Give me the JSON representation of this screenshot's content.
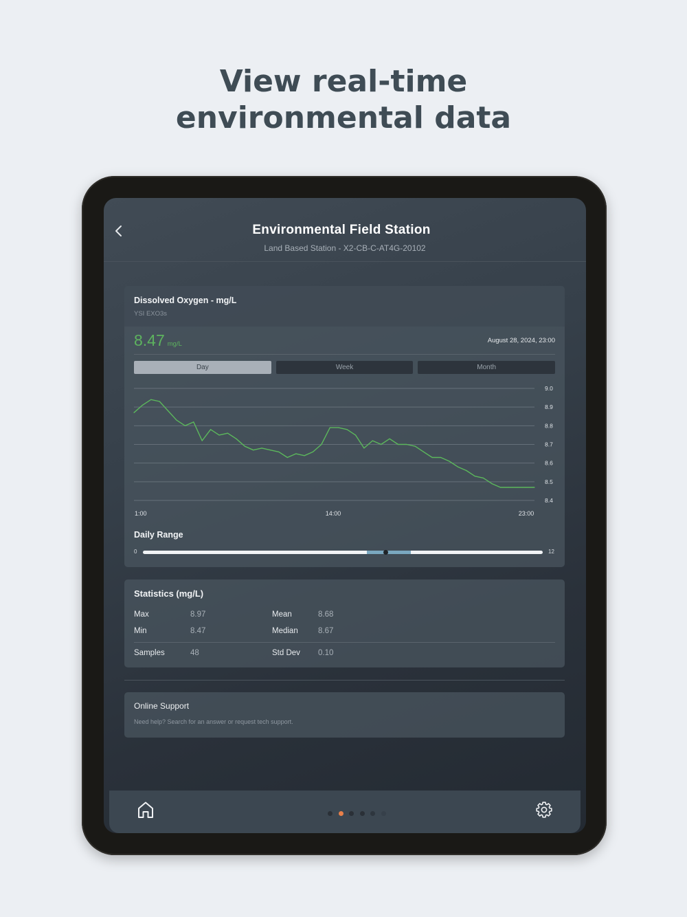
{
  "headline": {
    "line1": "View real-time",
    "line2": "environmental data"
  },
  "header": {
    "title": "Environmental Field Station",
    "subtitle": "Land Based Station - X2-CB-C-AT4G-20102"
  },
  "sensor": {
    "title": "Dissolved Oxygen - mg/L",
    "model": "YSI EXO3s",
    "value": "8.47",
    "unit": "mg/L",
    "timestamp": "August 28, 2024, 23:00",
    "value_color": "#5db35e"
  },
  "tabs": [
    {
      "label": "Day",
      "active": true
    },
    {
      "label": "Week",
      "active": false
    },
    {
      "label": "Month",
      "active": false
    }
  ],
  "chart_data": {
    "type": "line",
    "title": "",
    "xlabel": "",
    "ylabel": "",
    "ylim": [
      8.4,
      9.0
    ],
    "y_ticks": [
      "9.0",
      "8.9",
      "8.8",
      "8.7",
      "8.6",
      "8.5",
      "8.4"
    ],
    "x_tick_labels": [
      "1:00",
      "14:00",
      "23:00"
    ],
    "grid": true,
    "series": [
      {
        "color": "#5cb85c",
        "x": [
          1,
          1.5,
          2,
          2.5,
          3,
          3.5,
          4,
          4.5,
          5,
          5.5,
          6,
          6.5,
          7,
          7.5,
          8,
          8.5,
          9,
          9.5,
          10,
          10.5,
          11,
          11.5,
          12,
          12.5,
          13,
          13.5,
          14,
          14.5,
          15,
          15.5,
          16,
          16.5,
          17,
          17.5,
          18,
          18.5,
          19,
          19.5,
          20,
          20.5,
          21,
          21.5,
          22,
          22.5,
          23,
          23.5,
          24,
          24.5
        ],
        "values": [
          8.87,
          8.91,
          8.94,
          8.93,
          8.88,
          8.83,
          8.8,
          8.82,
          8.72,
          8.78,
          8.75,
          8.76,
          8.73,
          8.69,
          8.67,
          8.68,
          8.67,
          8.66,
          8.63,
          8.65,
          8.64,
          8.66,
          8.7,
          8.79,
          8.79,
          8.78,
          8.75,
          8.68,
          8.72,
          8.7,
          8.73,
          8.7,
          8.7,
          8.69,
          8.66,
          8.63,
          8.63,
          8.61,
          8.58,
          8.56,
          8.53,
          8.52,
          8.49,
          8.47,
          8.47,
          8.47,
          8.47,
          8.47
        ]
      }
    ]
  },
  "daily_range": {
    "title": "Daily Range",
    "min_label": "0",
    "max_label": "12",
    "range_low": 8.47,
    "range_high": 8.97,
    "current": 8.68,
    "scale_max": 12,
    "highlight_fraction_start": 0.56,
    "highlight_fraction_end": 0.67,
    "marker_fraction": 0.608
  },
  "statistics": {
    "title": "Statistics (mg/L)",
    "items": [
      {
        "label": "Max",
        "value": "8.97"
      },
      {
        "label": "Min",
        "value": "8.47"
      },
      {
        "label": "Mean",
        "value": "8.68"
      },
      {
        "label": "Median",
        "value": "8.67"
      },
      {
        "label": "Samples",
        "value": "48"
      },
      {
        "label": "Std Dev",
        "value": "0.10"
      }
    ]
  },
  "support": {
    "title": "Online Support",
    "subtitle": "Need help? Search for an answer or request tech support."
  },
  "nav": {
    "icons": [
      "home-icon",
      "gear-icon"
    ],
    "page_count": 6,
    "active_page": 1,
    "dot_colors": [
      "#2a3037",
      "#e8804a",
      "#2a3037",
      "#2a3037",
      "#2e363e",
      "#36404a"
    ]
  }
}
